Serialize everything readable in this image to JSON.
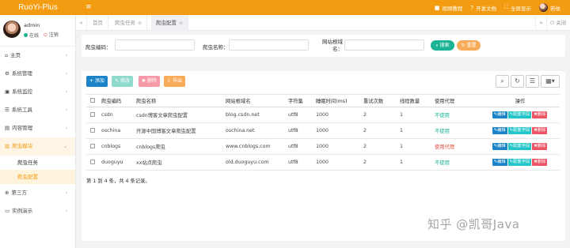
{
  "app": {
    "brand": "RuoYi-Plus"
  },
  "topbar": {
    "menu_icon": "≡",
    "links": [
      {
        "icon": "video-icon",
        "glyph": "■",
        "label": "视频教程"
      },
      {
        "icon": "dev-doc-icon",
        "glyph": "?",
        "label": "开发文档"
      },
      {
        "icon": "fullscreen-icon",
        "glyph": "⛶",
        "label": "全屏显示"
      }
    ],
    "user": "若依"
  },
  "sidebar": {
    "user_name": "admin",
    "status_online": "在线",
    "status_logout": "注销",
    "items": [
      {
        "icon": "⌂",
        "label": "主页"
      },
      {
        "icon": "⚙",
        "label": "系统管理"
      },
      {
        "icon": "▣",
        "label": "系统监控"
      },
      {
        "icon": "☰",
        "label": "系统工具"
      },
      {
        "icon": "▤",
        "label": "内容管理"
      },
      {
        "icon": "▥",
        "label": "爬虫模块"
      }
    ],
    "subitems": [
      {
        "label": "爬虫任务"
      },
      {
        "label": "爬虫配置"
      }
    ],
    "items_after": [
      {
        "icon": "⊕",
        "label": "第三方"
      },
      {
        "icon": "▭",
        "label": "实例演示"
      }
    ]
  },
  "tabs": [
    {
      "label": "首页"
    },
    {
      "label": "爬虫任务"
    },
    {
      "label": "爬虫配置"
    }
  ],
  "tabsbar": {
    "close_label": "关闭"
  },
  "search": {
    "fields": [
      {
        "label": "爬虫编码：",
        "value": ""
      },
      {
        "label": "爬虫名称：",
        "value": ""
      },
      {
        "label": "网站根域名：",
        "value": ""
      }
    ],
    "search_btn": "搜索",
    "reset_btn": "重置"
  },
  "toolbar": {
    "add": "+ 添加",
    "edit": "修改",
    "delete": "删除",
    "export": "导出"
  },
  "table": {
    "columns": [
      "爬虫编码",
      "爬虫名称",
      "网站根域名",
      "字符集",
      "睡眠时间(ms)",
      "重试次数",
      "线程数量",
      "使用代理",
      "操作"
    ],
    "rows": [
      {
        "code": "csdn",
        "name": "csdn博客文章爬虫配置",
        "domain": "blog.csdn.net",
        "charset": "utf8",
        "sleep": "1000",
        "retry": "2",
        "threads": "1",
        "proxy": "不使用",
        "proxy_status": "off"
      },
      {
        "code": "oschina",
        "name": "开源中国博客文章爬虫配置",
        "domain": "oschina.net",
        "charset": "utf8",
        "sleep": "1000",
        "retry": "2",
        "threads": "1",
        "proxy": "不使用",
        "proxy_status": "off"
      },
      {
        "code": "cnblogs",
        "name": "cnblogs爬虫",
        "domain": "www.cnblogs.com",
        "charset": "utf8",
        "sleep": "1000",
        "retry": "2",
        "threads": "1",
        "proxy": "使用代理",
        "proxy_status": "on"
      },
      {
        "code": "duoguyu",
        "name": "xx站点爬虫",
        "domain": "old.duoguyu.com",
        "charset": "utf8",
        "sleep": "1000",
        "retry": "2",
        "threads": "1",
        "proxy": "不使用",
        "proxy_status": "off"
      }
    ],
    "actions": {
      "edit": "编辑",
      "config": "配置字段",
      "delete": "删除"
    },
    "footer": "第 1 到 4 条，共 4 条记录。"
  },
  "watermark": "知乎 @凯哥Java"
}
